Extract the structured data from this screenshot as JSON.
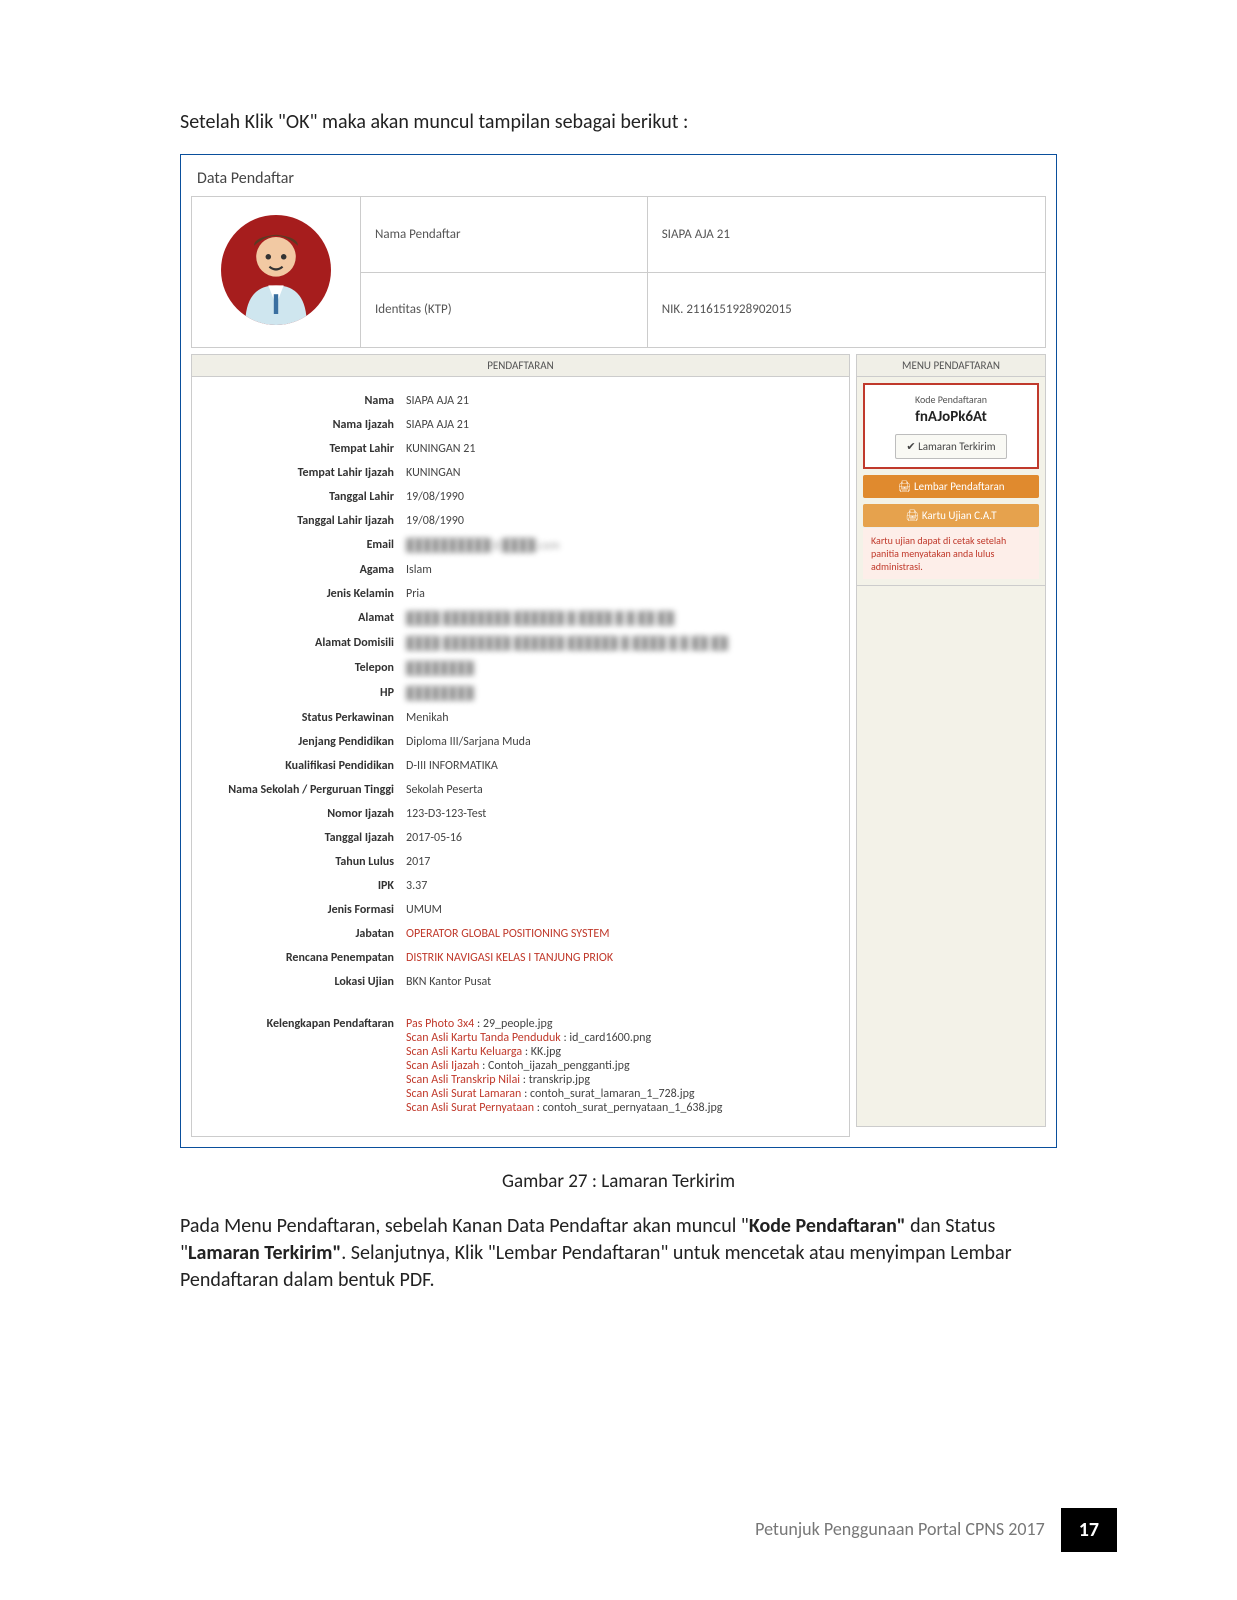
{
  "intro": "Setelah Klik \"OK\" maka akan muncul tampilan sebagai berikut :",
  "panel_title": "Data Pendaftar",
  "header": {
    "nama_label": "Nama Pendaftar",
    "nama_value": "SIAPA AJA 21",
    "id_label": "Identitas (KTP)",
    "id_value": "NIK. 2116151928902015"
  },
  "section": {
    "left": "PENDAFTARAN",
    "right": "MENU PENDAFTARAN"
  },
  "fields": {
    "nama": {
      "l": "Nama",
      "v": "SIAPA AJA 21"
    },
    "nama_ijazah": {
      "l": "Nama Ijazah",
      "v": "SIAPA AJA 21"
    },
    "tempat_lahir": {
      "l": "Tempat Lahir",
      "v": "KUNINGAN 21"
    },
    "tempat_lahir_ijazah": {
      "l": "Tempat Lahir Ijazah",
      "v": "KUNINGAN"
    },
    "tanggal_lahir": {
      "l": "Tanggal Lahir",
      "v": "19/08/1990"
    },
    "tanggal_lahir_ijazah": {
      "l": "Tanggal Lahir Ijazah",
      "v": "19/08/1990"
    },
    "email": {
      "l": "Email",
      "v": "██████████@████.com"
    },
    "agama": {
      "l": "Agama",
      "v": "Islam"
    },
    "jenis_kelamin": {
      "l": "Jenis Kelamin",
      "v": "Pria"
    },
    "alamat": {
      "l": "Alamat",
      "v": "████ ████████ ██████ █ ████ █ █ ██ ██"
    },
    "alamat_domisili": {
      "l": "Alamat Domisili",
      "v": "████ ████████ ██████ ██████ █ ████ █ █ ██ ██"
    },
    "telepon": {
      "l": "Telepon",
      "v": "████████"
    },
    "hp": {
      "l": "HP",
      "v": "████████"
    },
    "status_perkawinan": {
      "l": "Status Perkawinan",
      "v": "Menikah"
    },
    "jenjang": {
      "l": "Jenjang Pendidikan",
      "v": "Diploma III/Sarjana Muda"
    },
    "kualifikasi": {
      "l": "Kualifikasi Pendidikan",
      "v": "D-III INFORMATIKA"
    },
    "sekolah": {
      "l": "Nama Sekolah / Perguruan Tinggi",
      "v": "Sekolah Peserta"
    },
    "nomor_ijazah": {
      "l": "Nomor Ijazah",
      "v": "123-D3-123-Test"
    },
    "tanggal_ijazah": {
      "l": "Tanggal Ijazah",
      "v": "2017-05-16"
    },
    "tahun_lulus": {
      "l": "Tahun Lulus",
      "v": "2017"
    },
    "ipk": {
      "l": "IPK",
      "v": "3.37"
    },
    "jenis_formasi": {
      "l": "Jenis Formasi",
      "v": "UMUM"
    },
    "jabatan": {
      "l": "Jabatan",
      "v": "OPERATOR GLOBAL POSITIONING SYSTEM"
    },
    "rencana": {
      "l": "Rencana Penempatan",
      "v": "DISTRIK NAVIGASI KELAS I TANJUNG PRIOK"
    },
    "lokasi": {
      "l": "Lokasi Ujian",
      "v": "BKN Kantor Pusat"
    },
    "kelengkapan_label": "Kelengkapan Pendaftaran"
  },
  "attachments": {
    "a1": {
      "l": "Pas Photo 3x4",
      "v": "29_people.jpg"
    },
    "a2": {
      "l": "Scan Asli Kartu Tanda Penduduk",
      "v": "id_card1600.png"
    },
    "a3": {
      "l": "Scan Asli Kartu Keluarga",
      "v": "KK.jpg"
    },
    "a4": {
      "l": "Scan Asli Ijazah",
      "v": "Contoh_ijazah_pengganti.jpg"
    },
    "a5": {
      "l": "Scan Asli Transkrip Nilai",
      "v": "transkrip.jpg"
    },
    "a6": {
      "l": "Scan Asli Surat Lamaran",
      "v": "contoh_surat_lamaran_1_728.jpg"
    },
    "a7": {
      "l": "Scan Asli Surat Pernyataan",
      "v": "contoh_surat_pernyataan_1_638.jpg"
    }
  },
  "side": {
    "kode_label": "Kode Pendaftaran",
    "kode_value": "fnAJoPk6At",
    "status": "Lamaran Terkirim",
    "btn1": "Lembar Pendaftaran",
    "btn2": "Kartu Ujian C.A.T",
    "note": "Kartu ujian dapat di cetak setelah panitia menyatakan anda lulus administrasi."
  },
  "caption": "Gambar 27 : Lamaran Terkirim",
  "body": {
    "p1a": "Pada Menu Pendaftaran, sebelah Kanan Data Pendaftar akan muncul \"",
    "p1b": "Kode Pendaftaran\"",
    "p1c": " dan Status \"",
    "p1d": "Lamaran Terkirim\"",
    "p1e": ". Selanjutnya, Klik \"Lembar Pendaftaran\" untuk mencetak atau menyimpan Lembar Pendaftaran dalam bentuk PDF."
  },
  "footer": {
    "title": "Petunjuk Penggunaan Portal CPNS 2017",
    "page": "17"
  }
}
